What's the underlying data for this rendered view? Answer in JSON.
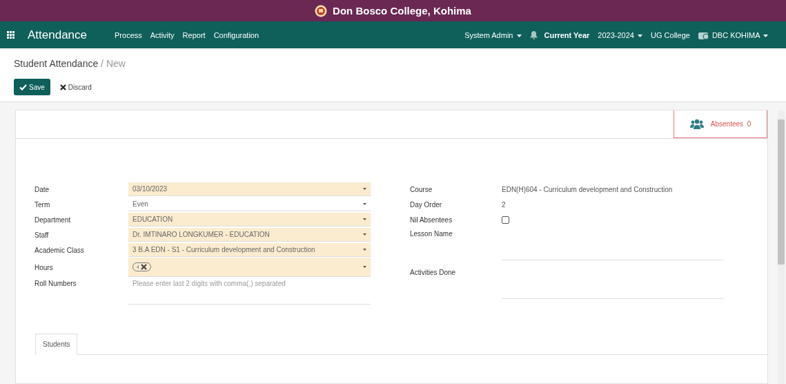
{
  "topbar": {
    "title": "Don Bosco College, Kohima"
  },
  "navbar": {
    "app": "Attendance",
    "menus": [
      "Process",
      "Activity",
      "Report",
      "Configuration"
    ],
    "user": "System Admin",
    "year_label": "Current Year",
    "year": "2023-2024",
    "college": "UG College",
    "company": "DBC KOHIMA"
  },
  "breadcrumb": {
    "parent": "Student Attendance",
    "separator": "/",
    "current": "New"
  },
  "actions": {
    "save": "Save",
    "discard": "Discard"
  },
  "smart_button": {
    "label": "Absentees",
    "count": "0"
  },
  "left_fields": [
    {
      "label": "Date",
      "kind": "select",
      "value": "03/10/2023",
      "required": true
    },
    {
      "label": "Term",
      "kind": "select",
      "value": "Even",
      "required": false
    },
    {
      "label": "Department",
      "kind": "select",
      "value": "EDUCATION",
      "required": true
    },
    {
      "label": "Staff",
      "kind": "select",
      "value": "Dr. IMTINARO LONGKUMER - EDUCATION",
      "required": true
    },
    {
      "label": "Academic Class",
      "kind": "select",
      "value": "3 B.A EDN - S1 - Curriculum development and Construction",
      "required": true
    },
    {
      "label": "Hours",
      "kind": "tags",
      "tags": [
        "4"
      ],
      "required": true
    },
    {
      "label": "Roll Numbers",
      "kind": "textarea",
      "placeholder": "Please enter last 2 digits with comma(,) separated",
      "required": false
    }
  ],
  "right_fields": [
    {
      "label": "Course",
      "kind": "text",
      "value": "EDN(H)604 - Curriculum development and Construction"
    },
    {
      "label": "Day Order",
      "kind": "text",
      "value": "2"
    },
    {
      "label": "Nil Absentees",
      "kind": "checkbox",
      "checked": false
    },
    {
      "label": "Lesson Name",
      "kind": "textarea"
    },
    {
      "label": "Activities Done",
      "kind": "textarea"
    }
  ],
  "tabs": [
    {
      "label": "Students",
      "selected": true
    }
  ]
}
